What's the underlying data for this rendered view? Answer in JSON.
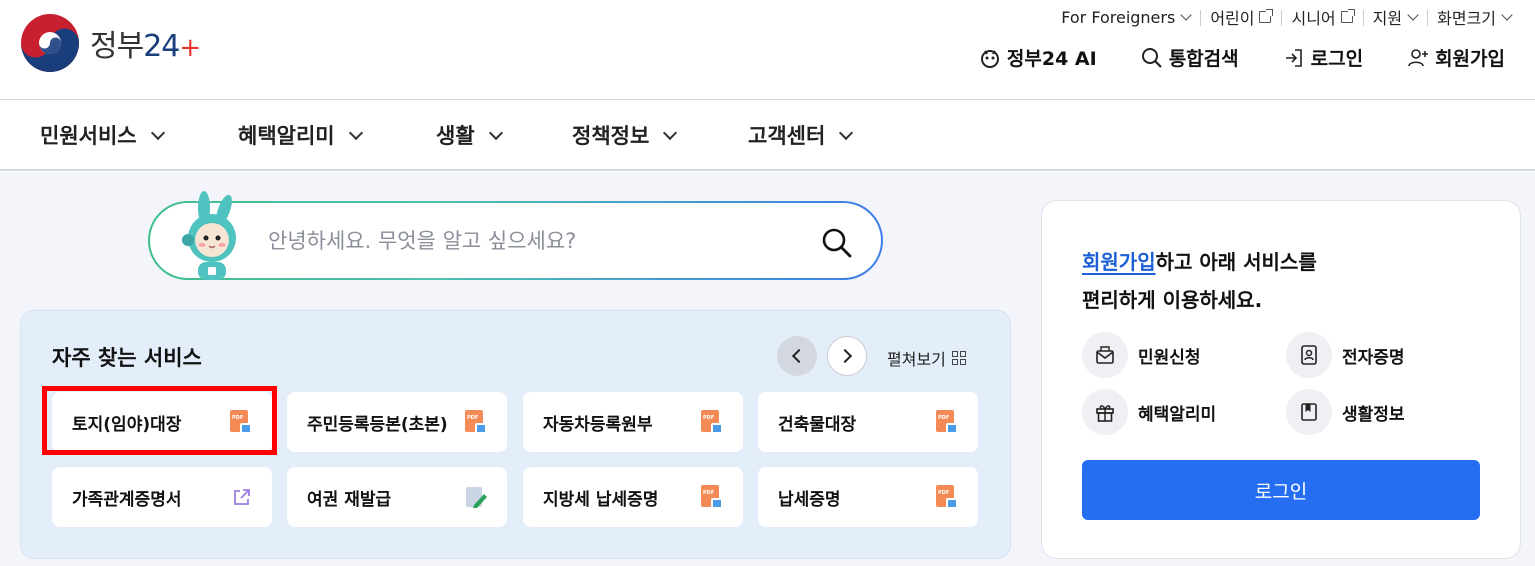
{
  "header": {
    "logo": {
      "text": "정부",
      "number": "24",
      "icon": "taegeuk-logo-icon"
    },
    "util": [
      {
        "label": "For Foreigners",
        "icon": "chevron-down-icon"
      },
      {
        "label": "어린이",
        "icon": "external-link-icon"
      },
      {
        "label": "시니어",
        "icon": "external-link-icon"
      },
      {
        "label": "지원",
        "icon": "chevron-down-icon"
      },
      {
        "label": "화면크기",
        "icon": "chevron-down-icon"
      }
    ],
    "actions": [
      {
        "label": "정부24 AI",
        "icon": "ai-mascot-icon"
      },
      {
        "label": "통합검색",
        "icon": "search-icon"
      },
      {
        "label": "로그인",
        "icon": "login-icon"
      },
      {
        "label": "회원가입",
        "icon": "add-user-icon"
      }
    ]
  },
  "gnb": [
    "민원서비스",
    "혜택알리미",
    "생활",
    "정책정보",
    "고객센터"
  ],
  "search": {
    "placeholder": "안녕하세요. 무엇을 알고 싶으세요?"
  },
  "frequent": {
    "title": "자주 찾는 서비스",
    "expand_label": "펼쳐보기",
    "services": [
      {
        "label": "토지(임야)대장",
        "icon": "pdf-icon"
      },
      {
        "label": "주민등록등본(초본)",
        "icon": "pdf-icon"
      },
      {
        "label": "자동차등록원부",
        "icon": "pdf-icon"
      },
      {
        "label": "건축물대장",
        "icon": "pdf-icon"
      },
      {
        "label": "가족관계증명서",
        "icon": "external-link-icon"
      },
      {
        "label": "여권 재발급",
        "icon": "edit-form-icon"
      },
      {
        "label": "지방세 납세증명",
        "icon": "pdf-icon"
      },
      {
        "label": "납세증명",
        "icon": "pdf-icon"
      }
    ]
  },
  "side": {
    "signup_link": "회원가입",
    "msg1": "하고 아래 서비스를",
    "msg2": "편리하게 이용하세요.",
    "quick": [
      {
        "label": "민원신청",
        "icon": "mail-icon"
      },
      {
        "label": "전자증명",
        "icon": "id-card-icon"
      },
      {
        "label": "혜택알리미",
        "icon": "gift-icon"
      },
      {
        "label": "생활정보",
        "icon": "bookmark-icon"
      }
    ],
    "login_label": "로그인"
  },
  "colors": {
    "primary": "#256ef4",
    "highlight": "#ff0000",
    "panel_bg": "#e4eefa",
    "page_bg": "#f3f5fb"
  }
}
